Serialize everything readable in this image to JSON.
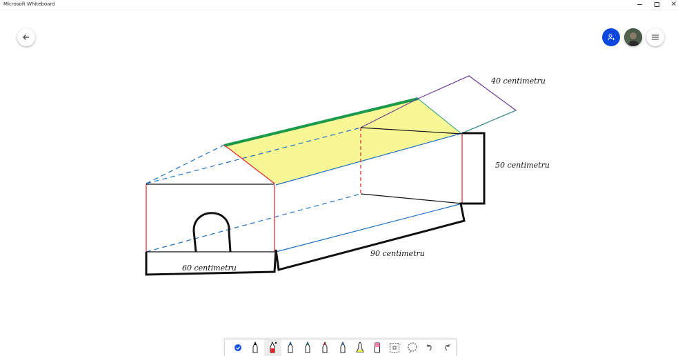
{
  "window": {
    "title": "Microsoft Whiteboard",
    "minimize_icon": "minimize-icon",
    "maximize_icon": "maximize-icon",
    "close_icon": "close-icon",
    "close_glyph": "✕"
  },
  "header": {
    "back_icon": "arrow-left-icon",
    "share_icon": "person-invite-icon",
    "avatar_icon": "user-avatar",
    "menu_icon": "hamburger-menu-icon",
    "accent_color": "#0e47e0"
  },
  "canvas": {
    "labels": {
      "top_depth": "40 centimetru",
      "height": "50 centimetru",
      "width": "60 centimetru",
      "length": "90 centimetru"
    },
    "colors": {
      "black_ink": "#111111",
      "red_ink": "#e0202a",
      "blue_ink": "#1a6fc4",
      "green_ink": "#1a9a4a",
      "purple_ink": "#6a3a9a",
      "highlighter": "#f5f57a"
    }
  },
  "toolbar": {
    "tools": [
      {
        "icon": "select-check-icon",
        "color": "#1a55e0"
      },
      {
        "icon": "pen-black-icon",
        "color": "#111111"
      },
      {
        "icon": "pen-red-icon",
        "color": "#e0202a",
        "active": true
      },
      {
        "icon": "pen-blue-icon",
        "color": "#1a6fc4"
      },
      {
        "icon": "pen-teal-icon",
        "color": "#1a8a8a"
      },
      {
        "icon": "pen-multicolor-icon",
        "color": "#d03030"
      },
      {
        "icon": "pen-gradient-icon",
        "color": "#3a7ac0"
      },
      {
        "icon": "highlighter-icon",
        "color": "#e8e840"
      },
      {
        "icon": "eraser-icon",
        "color": "#f08ab0"
      },
      {
        "icon": "ruler-icon",
        "color": "#555555"
      },
      {
        "icon": "lasso-icon",
        "color": "#555555"
      },
      {
        "icon": "undo-icon",
        "color": "#555555"
      },
      {
        "icon": "redo-icon",
        "color": "#555555"
      }
    ]
  }
}
